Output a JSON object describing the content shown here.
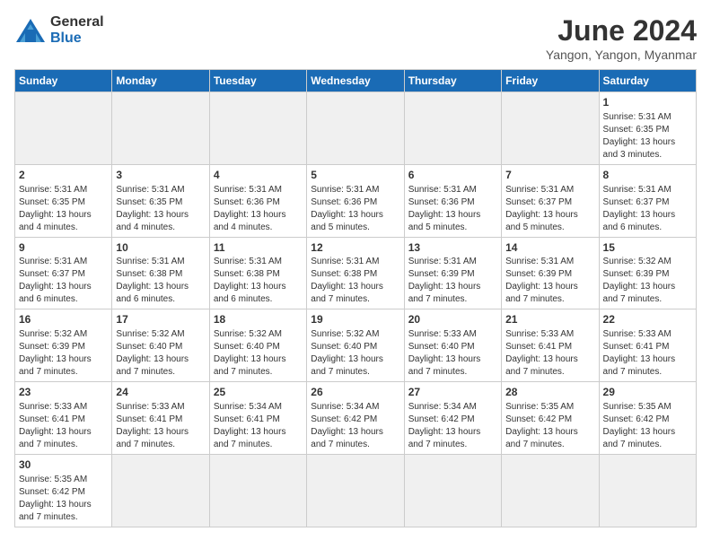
{
  "header": {
    "logo_general": "General",
    "logo_blue": "Blue",
    "title": "June 2024",
    "location": "Yangon, Yangon, Myanmar"
  },
  "days_of_week": [
    "Sunday",
    "Monday",
    "Tuesday",
    "Wednesday",
    "Thursday",
    "Friday",
    "Saturday"
  ],
  "weeks": [
    [
      {
        "day": "",
        "info": ""
      },
      {
        "day": "",
        "info": ""
      },
      {
        "day": "",
        "info": ""
      },
      {
        "day": "",
        "info": ""
      },
      {
        "day": "",
        "info": ""
      },
      {
        "day": "",
        "info": ""
      },
      {
        "day": "1",
        "info": "Sunrise: 5:31 AM\nSunset: 6:35 PM\nDaylight: 13 hours\nand 3 minutes."
      }
    ],
    [
      {
        "day": "2",
        "info": "Sunrise: 5:31 AM\nSunset: 6:35 PM\nDaylight: 13 hours\nand 4 minutes."
      },
      {
        "day": "3",
        "info": "Sunrise: 5:31 AM\nSunset: 6:35 PM\nDaylight: 13 hours\nand 4 minutes."
      },
      {
        "day": "4",
        "info": "Sunrise: 5:31 AM\nSunset: 6:36 PM\nDaylight: 13 hours\nand 4 minutes."
      },
      {
        "day": "5",
        "info": "Sunrise: 5:31 AM\nSunset: 6:36 PM\nDaylight: 13 hours\nand 5 minutes."
      },
      {
        "day": "6",
        "info": "Sunrise: 5:31 AM\nSunset: 6:36 PM\nDaylight: 13 hours\nand 5 minutes."
      },
      {
        "day": "7",
        "info": "Sunrise: 5:31 AM\nSunset: 6:37 PM\nDaylight: 13 hours\nand 5 minutes."
      },
      {
        "day": "8",
        "info": "Sunrise: 5:31 AM\nSunset: 6:37 PM\nDaylight: 13 hours\nand 6 minutes."
      }
    ],
    [
      {
        "day": "9",
        "info": "Sunrise: 5:31 AM\nSunset: 6:37 PM\nDaylight: 13 hours\nand 6 minutes."
      },
      {
        "day": "10",
        "info": "Sunrise: 5:31 AM\nSunset: 6:38 PM\nDaylight: 13 hours\nand 6 minutes."
      },
      {
        "day": "11",
        "info": "Sunrise: 5:31 AM\nSunset: 6:38 PM\nDaylight: 13 hours\nand 6 minutes."
      },
      {
        "day": "12",
        "info": "Sunrise: 5:31 AM\nSunset: 6:38 PM\nDaylight: 13 hours\nand 7 minutes."
      },
      {
        "day": "13",
        "info": "Sunrise: 5:31 AM\nSunset: 6:39 PM\nDaylight: 13 hours\nand 7 minutes."
      },
      {
        "day": "14",
        "info": "Sunrise: 5:31 AM\nSunset: 6:39 PM\nDaylight: 13 hours\nand 7 minutes."
      },
      {
        "day": "15",
        "info": "Sunrise: 5:32 AM\nSunset: 6:39 PM\nDaylight: 13 hours\nand 7 minutes."
      }
    ],
    [
      {
        "day": "16",
        "info": "Sunrise: 5:32 AM\nSunset: 6:39 PM\nDaylight: 13 hours\nand 7 minutes."
      },
      {
        "day": "17",
        "info": "Sunrise: 5:32 AM\nSunset: 6:40 PM\nDaylight: 13 hours\nand 7 minutes."
      },
      {
        "day": "18",
        "info": "Sunrise: 5:32 AM\nSunset: 6:40 PM\nDaylight: 13 hours\nand 7 minutes."
      },
      {
        "day": "19",
        "info": "Sunrise: 5:32 AM\nSunset: 6:40 PM\nDaylight: 13 hours\nand 7 minutes."
      },
      {
        "day": "20",
        "info": "Sunrise: 5:33 AM\nSunset: 6:40 PM\nDaylight: 13 hours\nand 7 minutes."
      },
      {
        "day": "21",
        "info": "Sunrise: 5:33 AM\nSunset: 6:41 PM\nDaylight: 13 hours\nand 7 minutes."
      },
      {
        "day": "22",
        "info": "Sunrise: 5:33 AM\nSunset: 6:41 PM\nDaylight: 13 hours\nand 7 minutes."
      }
    ],
    [
      {
        "day": "23",
        "info": "Sunrise: 5:33 AM\nSunset: 6:41 PM\nDaylight: 13 hours\nand 7 minutes."
      },
      {
        "day": "24",
        "info": "Sunrise: 5:33 AM\nSunset: 6:41 PM\nDaylight: 13 hours\nand 7 minutes."
      },
      {
        "day": "25",
        "info": "Sunrise: 5:34 AM\nSunset: 6:41 PM\nDaylight: 13 hours\nand 7 minutes."
      },
      {
        "day": "26",
        "info": "Sunrise: 5:34 AM\nSunset: 6:42 PM\nDaylight: 13 hours\nand 7 minutes."
      },
      {
        "day": "27",
        "info": "Sunrise: 5:34 AM\nSunset: 6:42 PM\nDaylight: 13 hours\nand 7 minutes."
      },
      {
        "day": "28",
        "info": "Sunrise: 5:35 AM\nSunset: 6:42 PM\nDaylight: 13 hours\nand 7 minutes."
      },
      {
        "day": "29",
        "info": "Sunrise: 5:35 AM\nSunset: 6:42 PM\nDaylight: 13 hours\nand 7 minutes."
      }
    ],
    [
      {
        "day": "30",
        "info": "Sunrise: 5:35 AM\nSunset: 6:42 PM\nDaylight: 13 hours\nand 7 minutes."
      },
      {
        "day": "",
        "info": ""
      },
      {
        "day": "",
        "info": ""
      },
      {
        "day": "",
        "info": ""
      },
      {
        "day": "",
        "info": ""
      },
      {
        "day": "",
        "info": ""
      },
      {
        "day": "",
        "info": ""
      }
    ]
  ]
}
